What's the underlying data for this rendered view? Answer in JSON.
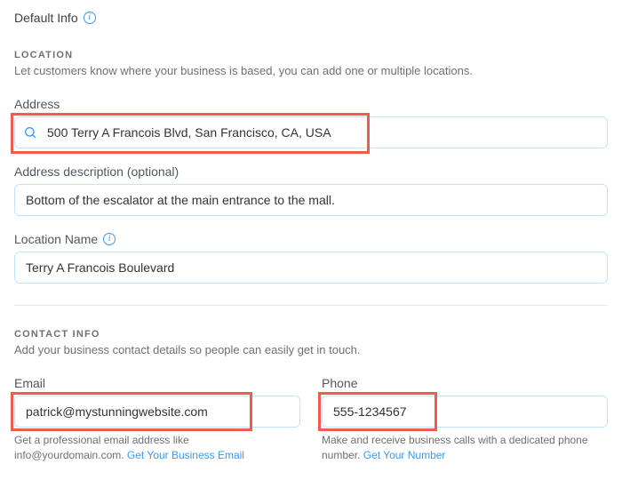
{
  "header": {
    "default_info": "Default Info"
  },
  "location": {
    "section_title": "LOCATION",
    "section_desc": "Let customers know where your business is based, you can add one or multiple locations.",
    "address_label": "Address",
    "address_value": "500 Terry A Francois Blvd, San Francisco, CA, USA",
    "desc_label": "Address description (optional)",
    "desc_value": "Bottom of the escalator at the main entrance to the mall.",
    "name_label": "Location Name",
    "name_value": "Terry A Francois Boulevard"
  },
  "contact": {
    "section_title": "CONTACT INFO",
    "section_desc": "Add your business contact details so people can easily get in touch.",
    "email_label": "Email",
    "email_value": "patrick@mystunningwebsite.com",
    "email_helper_pre": "Get a professional email address like info@yourdomain.com. ",
    "email_link": "Get Your Business Email",
    "phone_label": "Phone",
    "phone_value": "555-1234567",
    "phone_helper_pre": "Make and receive business calls with a dedicated phone number. ",
    "phone_link": "Get Your Number"
  }
}
